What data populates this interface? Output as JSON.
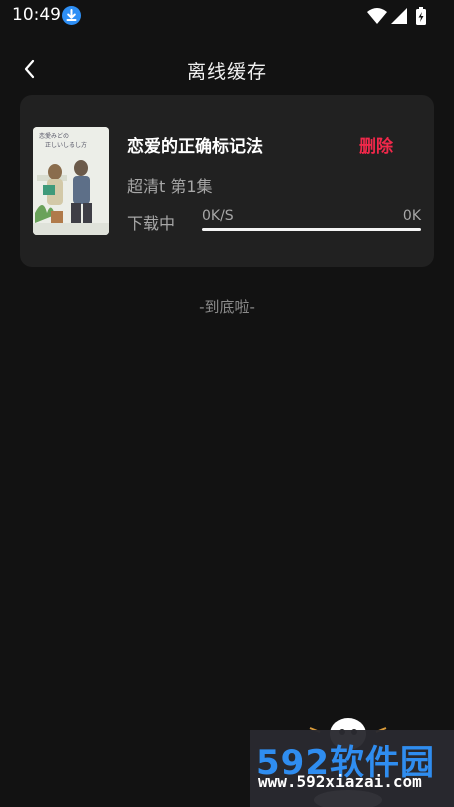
{
  "status_bar": {
    "time": "10:49",
    "icons": [
      "download-icon",
      "wifi-icon",
      "signal-icon",
      "battery-charging-icon"
    ]
  },
  "header": {
    "title": "离线缓存",
    "back_icon": "chevron-left-icon"
  },
  "item": {
    "title": "恋爱的正确标记法",
    "delete_label": "删除",
    "episode": "超清t  第1集",
    "status": "下载中",
    "speed": "0K/S",
    "size": "0K",
    "progress": 0.0,
    "cover_text": "恋愛みどの正しいしるし方"
  },
  "footer": {
    "end_text": "-到底啦-"
  },
  "watermark": {
    "brand": "592软件园",
    "url": "www.592xiazai.com"
  },
  "colors": {
    "background": "#121212",
    "card": "#212121",
    "accent": "#f0284a",
    "muted_text": "#a7a7a7"
  }
}
